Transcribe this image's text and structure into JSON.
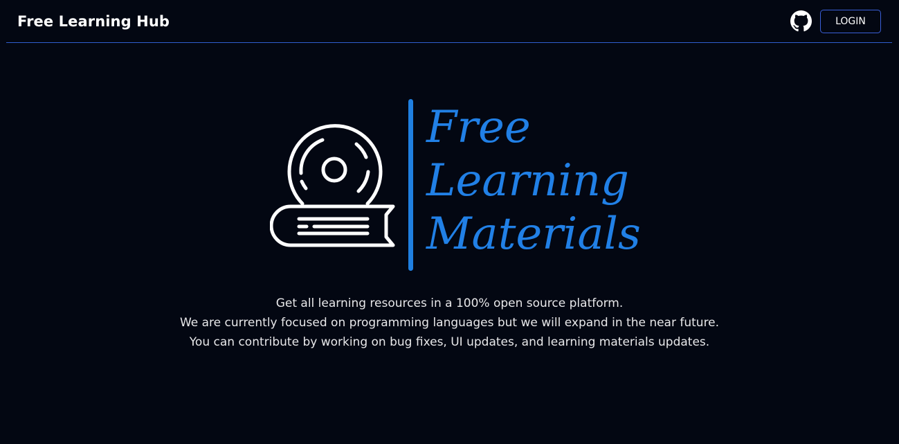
{
  "header": {
    "brand": "Free Learning Hub",
    "github_icon": "github-icon",
    "login_label": "LOGIN"
  },
  "hero": {
    "logo_icon": "book-with-globe-icon",
    "title_lines": [
      "Free",
      "Learning",
      "Materials"
    ],
    "description_lines": [
      "Get all learning resources in a 100% open source platform.",
      "We are currently focused on programming languages but we will expand in the near future.",
      "You can contribute by working on bug fixes, UI updates, and learning materials updates."
    ]
  },
  "colors": {
    "background": "#030712",
    "accent": "#2180e6",
    "border": "#2f5fd0",
    "text": "#ffffff"
  }
}
